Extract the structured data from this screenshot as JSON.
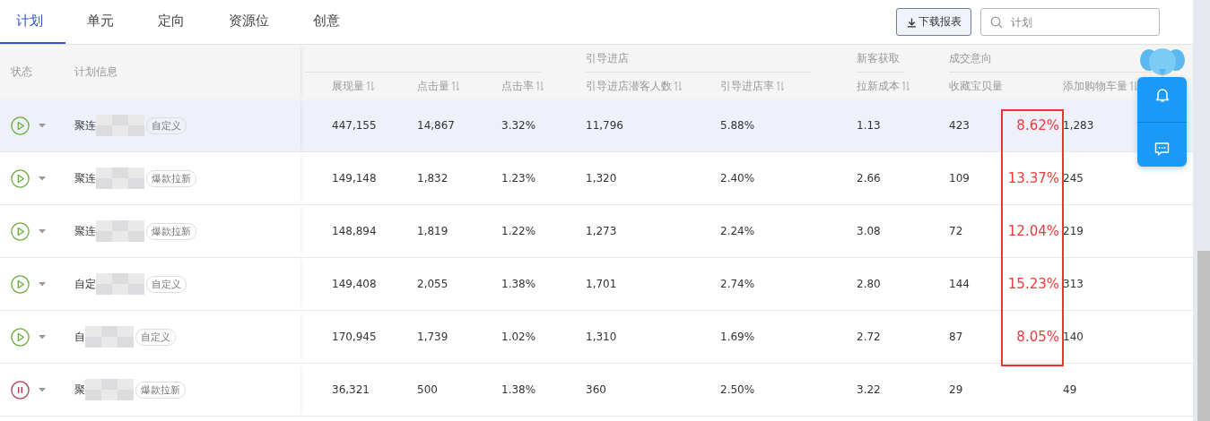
{
  "tabs": [
    {
      "label": "计划",
      "selected": true
    },
    {
      "label": "单元",
      "selected": false
    },
    {
      "label": "定向",
      "selected": false
    },
    {
      "label": "资源位",
      "selected": false
    },
    {
      "label": "创意",
      "selected": false
    }
  ],
  "download_button": "下载报表",
  "search": {
    "placeholder": "计划"
  },
  "header": {
    "status": "状态",
    "info": "计划信息",
    "groups": [
      {
        "columns": [
          "展现量",
          "点击量",
          "点击率"
        ]
      },
      {
        "label": "引导进店",
        "columns": [
          "引导进店潜客人数",
          "引导进店率"
        ]
      },
      {
        "label": "新客获取",
        "columns": [
          "拉新成本"
        ]
      },
      {
        "label": "成交意向",
        "columns": [
          "收藏宝贝量",
          "添加购物车量"
        ]
      }
    ]
  },
  "rows": [
    {
      "paused": false,
      "name": "聚连",
      "tag": "自定义",
      "highlighted": true,
      "values": [
        "447,155",
        "14,867",
        "3.32%",
        "11,796",
        "5.88%",
        "1.13",
        "423",
        "1,283"
      ],
      "annotation": "8.62%"
    },
    {
      "paused": false,
      "name": "聚连",
      "tag": "爆款拉新",
      "highlighted": false,
      "values": [
        "149,148",
        "1,832",
        "1.23%",
        "1,320",
        "2.40%",
        "2.66",
        "109",
        "245"
      ],
      "annotation": "13.37%"
    },
    {
      "paused": false,
      "name": "聚连",
      "tag": "爆款拉新",
      "highlighted": false,
      "values": [
        "148,894",
        "1,819",
        "1.22%",
        "1,273",
        "2.24%",
        "3.08",
        "72",
        "219"
      ],
      "annotation": "12.04%"
    },
    {
      "paused": false,
      "name": "自定",
      "tag": "自定义",
      "highlighted": false,
      "values": [
        "149,408",
        "2,055",
        "1.38%",
        "1,701",
        "2.74%",
        "2.80",
        "144",
        "313"
      ],
      "annotation": "15.23%"
    },
    {
      "paused": false,
      "name": "自",
      "tag": "自定义",
      "highlighted": false,
      "values": [
        "170,945",
        "1,739",
        "1.02%",
        "1,310",
        "1.69%",
        "2.72",
        "87",
        "140"
      ],
      "annotation": "8.05%"
    },
    {
      "paused": true,
      "name": "聚",
      "tag": "爆款拉新",
      "highlighted": false,
      "values": [
        "36,321",
        "500",
        "1.38%",
        "360",
        "2.50%",
        "3.22",
        "29",
        "49"
      ]
    }
  ]
}
